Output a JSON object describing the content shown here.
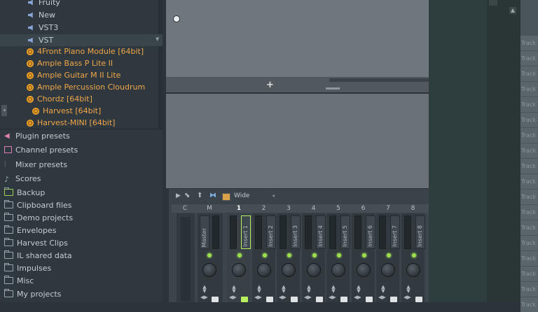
{
  "browser": {
    "top_items": [
      {
        "label": "Fruity",
        "icon": "speaker-icon"
      },
      {
        "label": "New",
        "icon": "speaker-icon"
      },
      {
        "label": "VST3",
        "icon": "speaker-icon"
      },
      {
        "label": "VST",
        "icon": "speaker-icon"
      }
    ],
    "plugins": [
      "4Front Piano Module [64bit]",
      "Ample Bass P Lite II",
      "Ample Guitar M II Lite",
      "Ample Percussion Cloudrum",
      "Chordz [64bit]",
      "Harvest [64bit]",
      "Harvest-MINI [64bit]"
    ],
    "categories": [
      {
        "label": "Plugin presets",
        "icon": "plug-icon"
      },
      {
        "label": "Channel presets",
        "icon": "channel-icon"
      },
      {
        "label": "Mixer presets",
        "icon": "mixer-icon"
      },
      {
        "label": "Scores",
        "icon": "note-icon"
      },
      {
        "label": "Backup",
        "icon": "backup-folder-icon"
      },
      {
        "label": "Clipboard files",
        "icon": "folder-icon"
      },
      {
        "label": "Demo projects",
        "icon": "folder-icon"
      },
      {
        "label": "Envelopes",
        "icon": "folder-icon"
      },
      {
        "label": "Harvest Clips",
        "icon": "folder-icon"
      },
      {
        "label": "IL shared data",
        "icon": "folder-icon"
      },
      {
        "label": "Impulses",
        "icon": "folder-icon"
      },
      {
        "label": "Misc",
        "icon": "folder-icon"
      },
      {
        "label": "My projects",
        "icon": "folder-icon"
      }
    ]
  },
  "topwin": {
    "add_symbol": "+"
  },
  "mixer": {
    "toolbar_label": "Wide",
    "head_c": "C",
    "head_m": "M",
    "channels": [
      "1",
      "2",
      "3",
      "4",
      "5",
      "6",
      "7",
      "8"
    ],
    "master_label": "Master",
    "inserts": [
      "Insert 1",
      "Insert 2",
      "Insert 3",
      "Insert 4",
      "Insert 5",
      "Insert 6",
      "Insert 7",
      "Insert 8"
    ],
    "selected_insert_index": 0
  },
  "playlist": {
    "track_label": "Track",
    "track_count": 20
  },
  "colors": {
    "plugin_text": "#f0a64a",
    "led": "#9be04a",
    "selected_fader": "#b8f060"
  }
}
